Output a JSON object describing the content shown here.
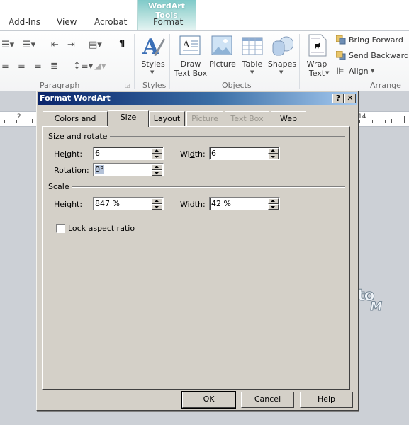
{
  "ribbon": {
    "tabs": [
      {
        "label": "Add-Ins"
      },
      {
        "label": "View"
      },
      {
        "label": "Acrobat"
      },
      {
        "label": "Format"
      }
    ],
    "contextual_group": "WordArt Tools",
    "accent_color": "#7fcac9",
    "groups": {
      "paragraph": {
        "label": "Paragraph",
        "icons": [
          "bullets-icon",
          "numbering-icon",
          "decrease-indent-icon",
          "increase-indent-icon",
          "columns-icon",
          "pilcrow-icon",
          "align-left-icon",
          "center-icon",
          "align-right-icon",
          "justify-icon",
          "line-spacing-icon",
          "shading-icon"
        ],
        "pilcrow": "¶"
      },
      "styles": {
        "label": "Styles",
        "button": "Styles"
      },
      "objects": {
        "label": "Objects",
        "buttons": [
          {
            "label1": "Draw",
            "label2": "Text Box"
          },
          {
            "label1": "Picture",
            "label2": ""
          },
          {
            "label1": "Table",
            "label2": ""
          },
          {
            "label1": "Shapes",
            "label2": ""
          }
        ]
      },
      "arrange": {
        "label": "Arrange",
        "wrap_label1": "Wrap",
        "wrap_label2": "Text",
        "bring_forward": "Bring Forward",
        "send_backward": "Send Backward",
        "align": "Align"
      }
    }
  },
  "ruler": {
    "left_num": "2",
    "right_num": "14"
  },
  "document": {
    "wordart_line1": "to",
    "wordart_line2": "M"
  },
  "dialog": {
    "title": "Format WordArt",
    "help_glyph": "?",
    "close_glyph": "✕",
    "tabs": [
      {
        "label": "Colors and Lines",
        "state": "normal"
      },
      {
        "label": "Size",
        "state": "active"
      },
      {
        "label": "Layout",
        "state": "normal"
      },
      {
        "label": "Picture",
        "state": "disabled"
      },
      {
        "label": "Text Box",
        "state": "disabled"
      },
      {
        "label": "Web",
        "state": "normal"
      }
    ],
    "size_rotate": {
      "section_label": "Size and rotate",
      "height_label": "Height:",
      "height_value": "6",
      "width_label": "Width:",
      "width_value": "6",
      "rotation_label": "Rotation:",
      "rotation_value": "0°"
    },
    "scale": {
      "section_label": "Scale",
      "height_label": "Height:",
      "height_value": "847 %",
      "width_label": "Width:",
      "width_value": "42 %"
    },
    "lock_aspect": {
      "label": "Lock aspect ratio",
      "checked": false
    },
    "buttons": {
      "ok": "OK",
      "cancel": "Cancel",
      "help": "Help"
    }
  }
}
